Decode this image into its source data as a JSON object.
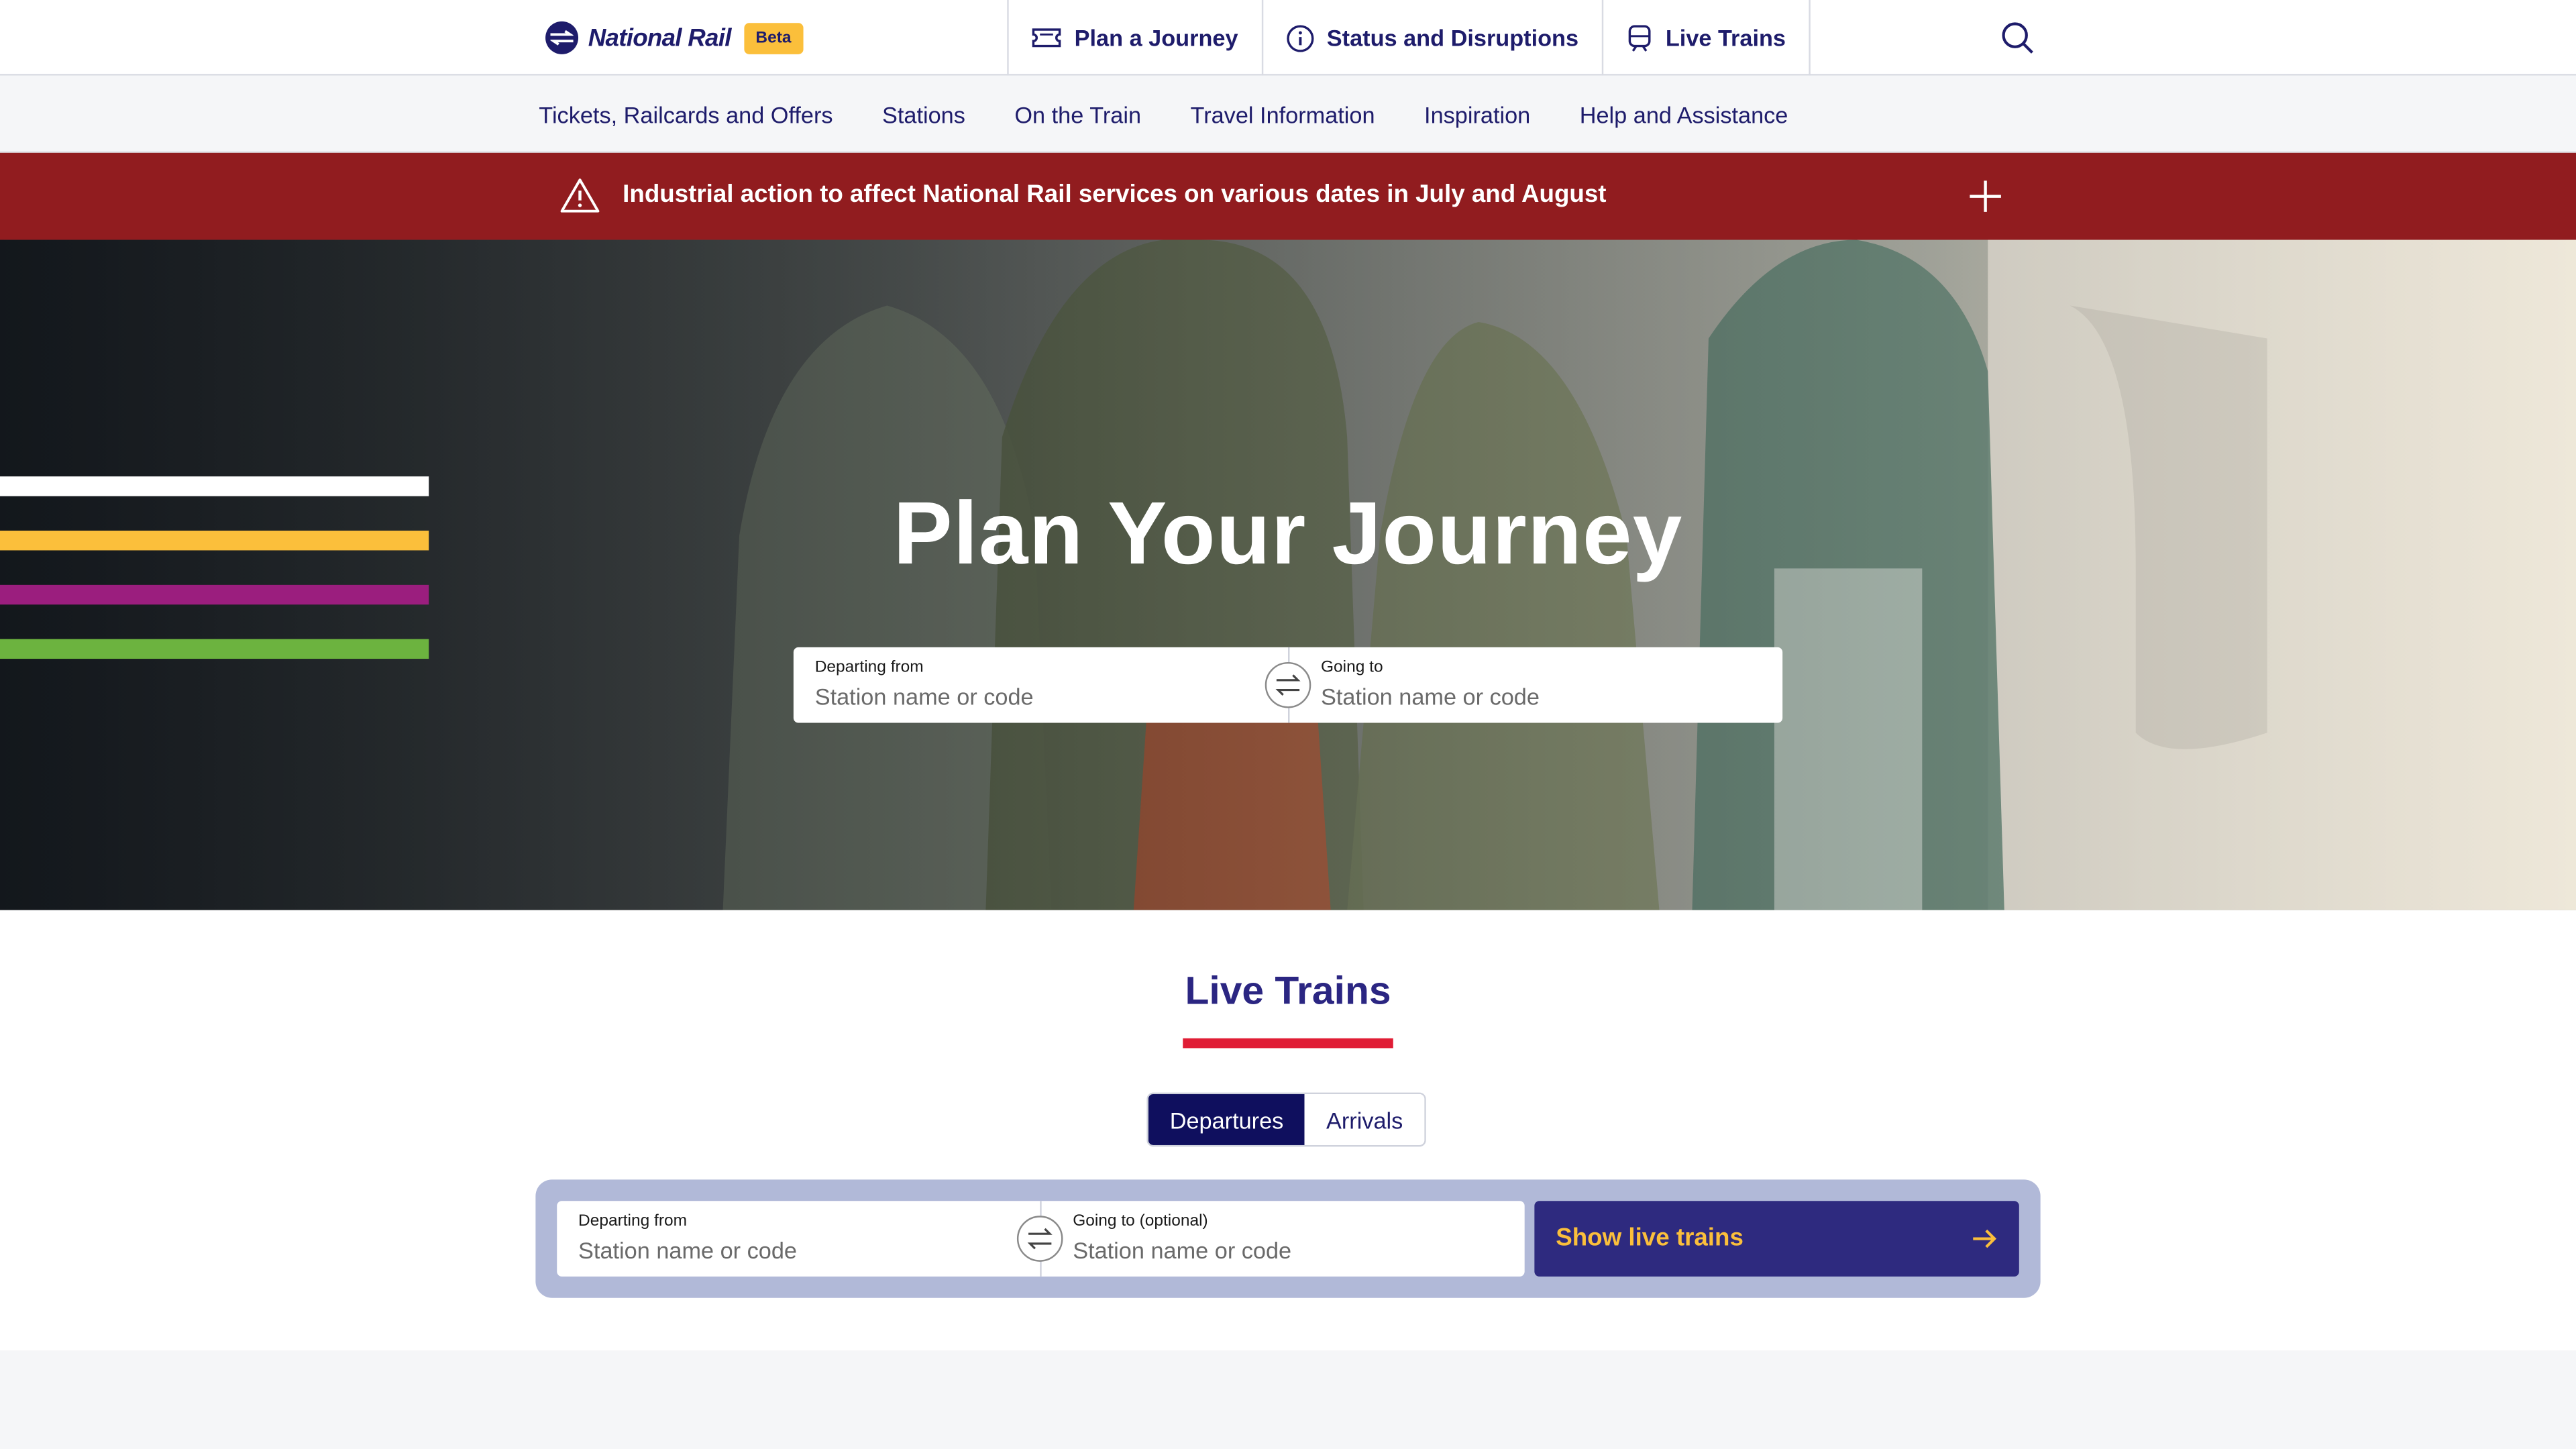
{
  "header": {
    "logo_text": "National Rail",
    "beta_badge": "Beta",
    "nav": [
      {
        "label": "Plan a Journey",
        "icon": "ticket-icon"
      },
      {
        "label": "Status and Disruptions",
        "icon": "info-icon"
      },
      {
        "label": "Live Trains",
        "icon": "train-icon"
      }
    ],
    "search_icon": "search-icon"
  },
  "subnav": {
    "items": [
      "Tickets, Railcards and Offers",
      "Stations",
      "On the Train",
      "Travel Information",
      "Inspiration",
      "Help and Assistance"
    ]
  },
  "alert": {
    "text": "Industrial action to affect National Rail services on various dates in July and August",
    "icon": "warning-icon",
    "expand_icon": "plus-icon",
    "color": "#911c1f"
  },
  "hero": {
    "title": "Plan Your Journey",
    "stripe_colors": [
      "#ffffff",
      "#fbbf3b",
      "#9b1e7e",
      "#6cb33f"
    ],
    "from": {
      "label": "Departing from",
      "placeholder": "Station name or code"
    },
    "to": {
      "label": "Going to",
      "placeholder": "Station name or code"
    }
  },
  "live_trains": {
    "title": "Live Trains",
    "tabs": [
      "Departures",
      "Arrivals"
    ],
    "active_tab": "Departures",
    "from": {
      "label": "Departing from",
      "placeholder": "Station name or code"
    },
    "to": {
      "label": "Going to (optional)",
      "placeholder": "Station name or code"
    },
    "button": "Show live trains"
  },
  "colors": {
    "brand_navy": "#1e1c6b",
    "accent_yellow": "#fbbf3b",
    "accent_red": "#e01d35"
  }
}
